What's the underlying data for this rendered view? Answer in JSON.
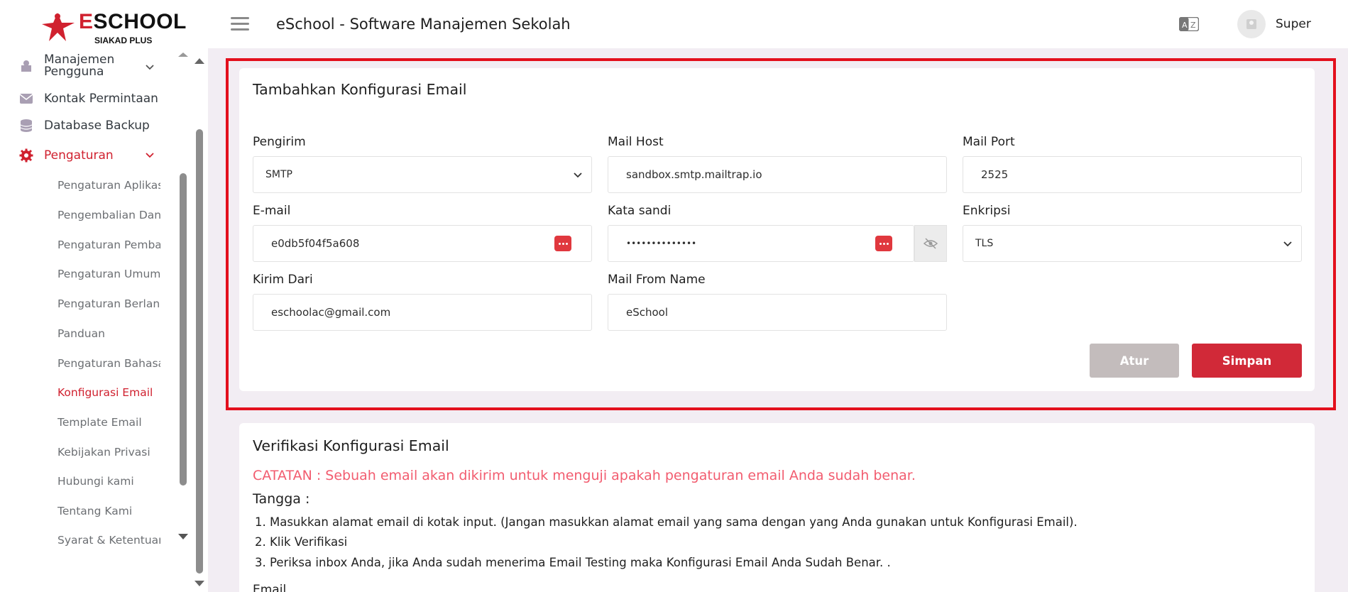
{
  "brand": {
    "name_e": "E",
    "name_rest": "SCHOOL",
    "sub": "SIAKAD PLUS"
  },
  "sidebar": {
    "items": [
      {
        "label_line1": "Manajemen",
        "label_line2": "Pengguna",
        "icon": "users-icon"
      },
      {
        "label": "Kontak Permintaan",
        "icon": "envelope-icon"
      },
      {
        "label": "Database Backup",
        "icon": "database-icon"
      },
      {
        "label": "Pengaturan",
        "icon": "gear-icon"
      }
    ],
    "submenu": [
      "Pengaturan Aplikasi",
      "Pengembalian Dana",
      "Pengaturan Pembayaran",
      "Pengaturan Umum",
      "Pengaturan Berlangganan",
      "Panduan",
      "Pengaturan Bahasa",
      "Konfigurasi Email",
      "Template Email",
      "Kebijakan Privasi",
      "Hubungi kami",
      "Tentang Kami",
      "Syarat & Ketentuan"
    ],
    "active_submenu": "Konfigurasi Email"
  },
  "topbar": {
    "title": "eSchool - Software Manajemen Sekolah",
    "user": "Super"
  },
  "config_form": {
    "title": "Tambahkan Konfigurasi Email",
    "mailer_label": "Pengirim",
    "mailer_value": "SMTP",
    "host_label": "Mail Host",
    "host_value": "sandbox.smtp.mailtrap.io",
    "port_label": "Mail Port",
    "port_value": "2525",
    "email_label": "E-mail",
    "email_value": "e0db5f04f5a608",
    "password_label": "Kata sandi",
    "password_value": "••••••••••••••",
    "encryption_label": "Enkripsi",
    "encryption_value": "TLS",
    "from_label": "Kirim Dari",
    "from_value": "eschoolac@gmail.com",
    "from_name_label": "Mail From Name",
    "from_name_value": "eSchool",
    "reset_button": "Atur",
    "save_button": "Simpan"
  },
  "verify": {
    "title": "Verifikasi Konfigurasi Email",
    "note": "CATATAN : Sebuah email akan dikirim untuk menguji apakah pengaturan email Anda sudah benar.",
    "steps_title": "Tangga :",
    "steps": [
      "1. Masukkan alamat email di kotak input. (Jangan masukkan alamat email yang sama dengan yang Anda gunakan untuk Konfigurasi Email).",
      "2. Klik Verifikasi",
      "3. Periksa inbox Anda, jika Anda sudah menerima Email Testing maka Konfigurasi Email Anda Sudah Benar. ."
    ],
    "email_label": "Email"
  },
  "colors": {
    "accent": "#d12938",
    "outline": "#e3101d",
    "note": "#f25c6f"
  }
}
